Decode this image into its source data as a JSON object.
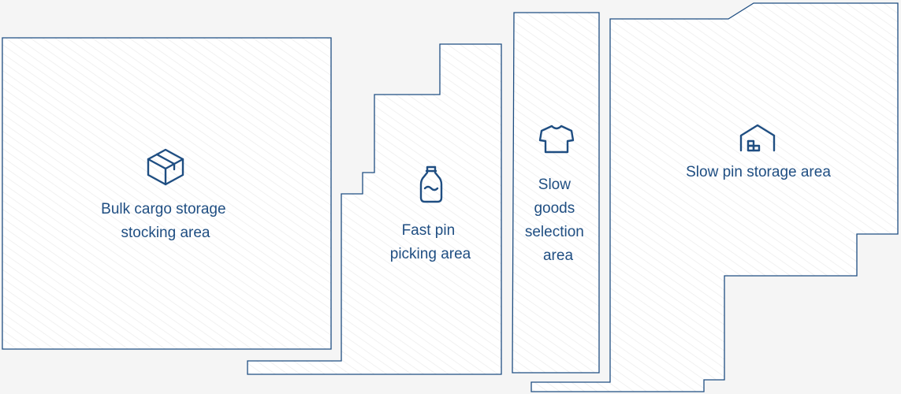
{
  "colors": {
    "background": "#f5f5f5",
    "zone_fill": "#ffffff",
    "zone_hatch": "#eeeeee",
    "outline": "#1f4e82",
    "label": "#1f4e82",
    "icon": "#1f4e82"
  },
  "zones": [
    {
      "id": "bulk",
      "icon": "box-icon",
      "label_lines": [
        "Bulk cargo storage",
        "stocking area"
      ]
    },
    {
      "id": "fast-pin",
      "icon": "bottle-icon",
      "label_lines": [
        "Fast pin",
        "picking area"
      ]
    },
    {
      "id": "slow-goods",
      "icon": "tshirt-icon",
      "label_lines": [
        "Slow",
        "goods",
        "selection",
        "area"
      ]
    },
    {
      "id": "slow-pin",
      "icon": "warehouse-icon",
      "label_lines": [
        "Slow pin storage area"
      ]
    }
  ]
}
